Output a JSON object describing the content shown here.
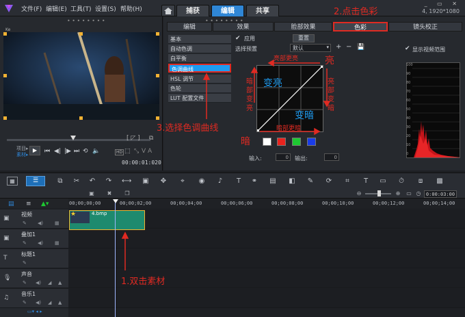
{
  "menu": [
    "文件(F)",
    "编辑(E)",
    "工具(T)",
    "设置(S)",
    "帮助(H)"
  ],
  "mode_tabs": [
    "捕获",
    "编辑",
    "共享"
  ],
  "resolution": "4, 1920*1080",
  "preview": {
    "label_item": "项目▸",
    "label_clip": "素材▸",
    "timecode": "00:00:01:020",
    "hd_badge": "HD",
    "thumb_label": "Ke"
  },
  "options_tabs": [
    "编辑",
    "效果",
    "脸部效果",
    "色彩",
    "镜头校正"
  ],
  "categories": [
    "基本",
    "自动色调",
    "白平衡",
    "色调曲线",
    "HSL 调节",
    "色轮",
    "LUT 配置文件"
  ],
  "color_controls": {
    "apply_label": "应用",
    "reset_label": "重置",
    "preset_label": "选择预置",
    "preset_value": "默认",
    "show_range_label": "显示视频范围",
    "input_label": "输入:",
    "input_value": "0",
    "output_label": "输出:",
    "output_value": "0"
  },
  "swatches": [
    "#ffffff",
    "#e8231e",
    "#1ec832",
    "#1a3ce8"
  ],
  "histogram_ticks": [
    "100",
    "90",
    "80",
    "70",
    "60",
    "50",
    "40",
    "30",
    "20",
    "10",
    "0"
  ],
  "ruler_ticks": [
    "00;00;00;00",
    "00;00;02;00",
    "00;00;04;00",
    "00;00;06;00",
    "00;00;08;00",
    "00;00;10;00",
    "00;00;12;00",
    "00;00;14;00"
  ],
  "zoom_time": "0:00:03:00",
  "tracks": [
    {
      "name": "视频",
      "icon": "video-track-icon"
    },
    {
      "name": "叠加1",
      "icon": "overlay-track-icon"
    },
    {
      "name": "标题1",
      "icon": "title-track-icon"
    },
    {
      "name": "声音",
      "icon": "voice-track-icon"
    },
    {
      "name": "音乐1",
      "icon": "music-track-icon"
    }
  ],
  "clip": {
    "name": "4.bmp"
  },
  "annotations": {
    "step1": "1.双击素材",
    "step2": "2.点击色彩",
    "step3": "3.选择色调曲线",
    "bright": "亮",
    "dark": "暗",
    "top_brighter": "亮部更亮",
    "brighten": "变亮",
    "darken": "变暗",
    "dark_brighten": "暗部变亮",
    "bright_darken": "亮部变暗",
    "dark_darker": "暗部更暗"
  },
  "colors": {
    "accent": "#2f86d6",
    "annotation": "#e02a22",
    "clip": "#1e8a6e",
    "highlight": "#1e9bf0"
  }
}
